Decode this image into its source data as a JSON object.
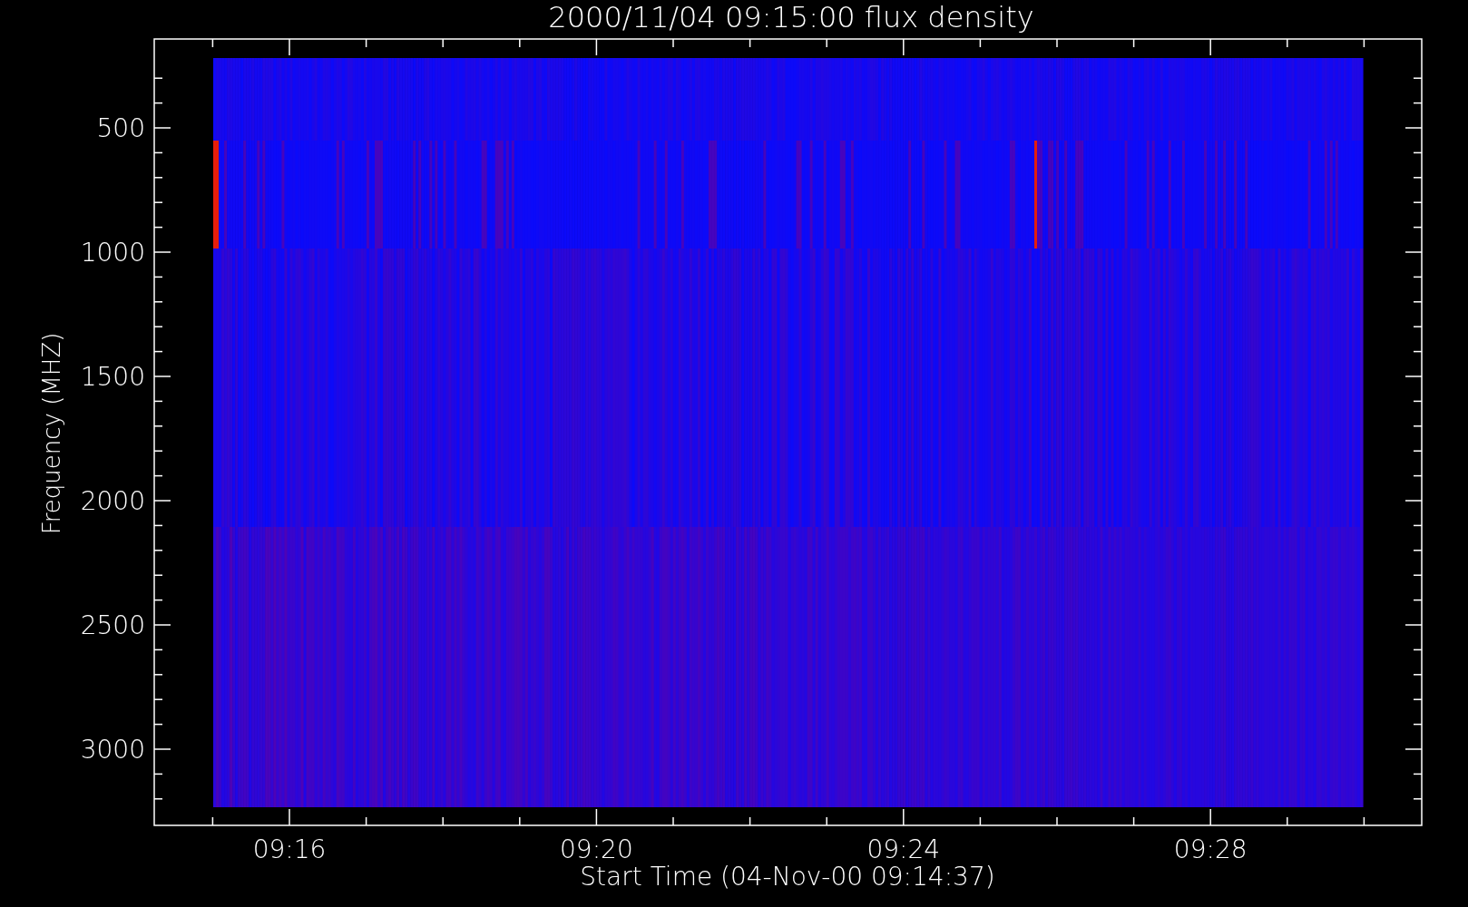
{
  "plot": {
    "title": "2000/11/04 09:15:00 flux density",
    "y_axis": {
      "label": "Frequency (MHZ)",
      "ticks": [
        "500",
        "1000",
        "1500",
        "2000",
        "2500",
        "3000"
      ]
    },
    "x_axis": {
      "label": "Start Time (04-Nov-00 09:14:37)",
      "ticks": [
        "09:16",
        "09:20",
        "09:24",
        "09:28"
      ]
    }
  }
}
